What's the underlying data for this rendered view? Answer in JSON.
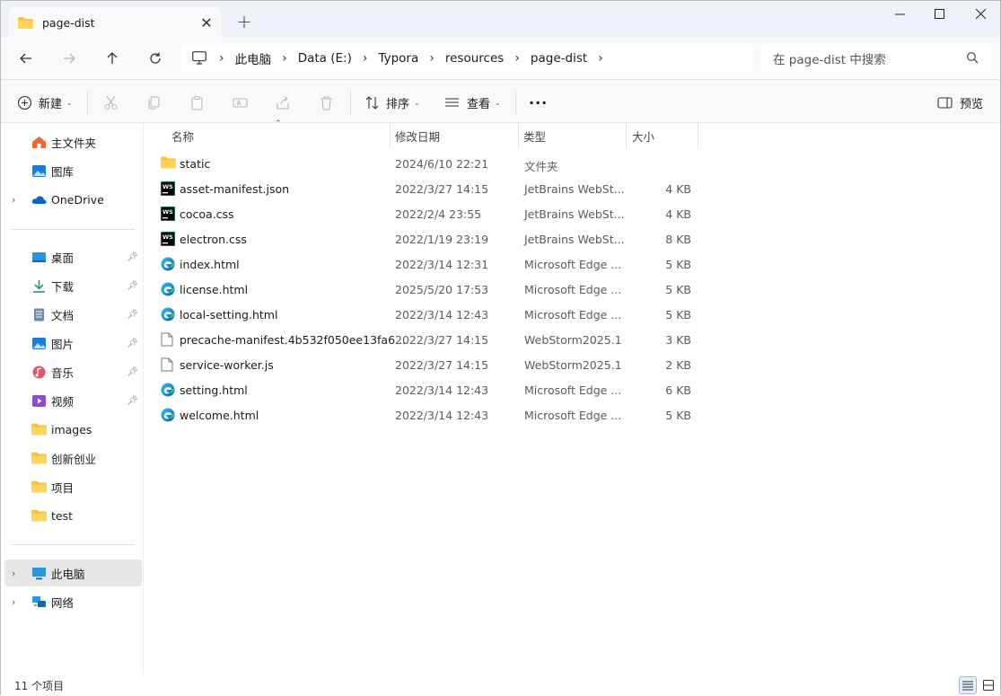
{
  "window": {
    "tab_title": "page-dist",
    "new_tab": "+",
    "minimize": "—",
    "maximize": "☐",
    "close": "✕"
  },
  "address": {
    "segments": [
      "此电脑",
      "Data (E:)",
      "Typora",
      "resources",
      "page-dist"
    ],
    "search_placeholder": "在 page-dist 中搜索"
  },
  "toolbar": {
    "new_label": "新建",
    "sort_label": "排序",
    "view_label": "查看",
    "more_label": "···",
    "preview_label": "预览"
  },
  "sidebar": {
    "items": [
      {
        "label": "主文件夹",
        "icon": "home-icon"
      },
      {
        "label": "图库",
        "icon": "gallery-icon"
      },
      {
        "label": "OneDrive",
        "icon": "cloud-icon"
      },
      {
        "label": "桌面",
        "icon": "desktop-icon",
        "pinned": true
      },
      {
        "label": "下载",
        "icon": "download-icon",
        "pinned": true
      },
      {
        "label": "文档",
        "icon": "document-icon",
        "pinned": true
      },
      {
        "label": "图片",
        "icon": "pictures-icon",
        "pinned": true
      },
      {
        "label": "音乐",
        "icon": "music-icon",
        "pinned": true
      },
      {
        "label": "视频",
        "icon": "video-icon",
        "pinned": true
      },
      {
        "label": "images",
        "icon": "folder-icon"
      },
      {
        "label": "创新创业",
        "icon": "folder-icon"
      },
      {
        "label": "项目",
        "icon": "folder-icon"
      },
      {
        "label": "test",
        "icon": "folder-icon"
      },
      {
        "label": "此电脑",
        "icon": "this-pc-icon"
      },
      {
        "label": "网络",
        "icon": "network-icon"
      }
    ]
  },
  "columns": {
    "name": "名称",
    "date": "修改日期",
    "type": "类型",
    "size": "大小"
  },
  "files": [
    {
      "name": "static",
      "date": "2024/6/10 22:21",
      "type": "文件夹",
      "size": "",
      "icon": "folder"
    },
    {
      "name": "asset-manifest.json",
      "date": "2022/3/27 14:15",
      "type": "JetBrains WebSt...",
      "size": "4 KB",
      "icon": "webstorm"
    },
    {
      "name": "cocoa.css",
      "date": "2022/2/4 23:55",
      "type": "JetBrains WebSt...",
      "size": "4 KB",
      "icon": "webstorm"
    },
    {
      "name": "electron.css",
      "date": "2022/1/19 23:19",
      "type": "JetBrains WebSt...",
      "size": "8 KB",
      "icon": "webstorm"
    },
    {
      "name": "index.html",
      "date": "2022/3/14 12:31",
      "type": "Microsoft Edge ...",
      "size": "5 KB",
      "icon": "edge"
    },
    {
      "name": "license.html",
      "date": "2025/5/20 17:53",
      "type": "Microsoft Edge ...",
      "size": "5 KB",
      "icon": "edge"
    },
    {
      "name": "local-setting.html",
      "date": "2022/3/14 12:43",
      "type": "Microsoft Edge ...",
      "size": "5 KB",
      "icon": "edge"
    },
    {
      "name": "precache-manifest.4b532f050ee13fa6...",
      "date": "2022/3/27 14:15",
      "type": "WebStorm2025.1",
      "size": "3 KB",
      "icon": "blank"
    },
    {
      "name": "service-worker.js",
      "date": "2022/3/27 14:15",
      "type": "WebStorm2025.1",
      "size": "2 KB",
      "icon": "blank"
    },
    {
      "name": "setting.html",
      "date": "2022/3/14 12:43",
      "type": "Microsoft Edge ...",
      "size": "6 KB",
      "icon": "edge"
    },
    {
      "name": "welcome.html",
      "date": "2022/3/14 12:43",
      "type": "Microsoft Edge ...",
      "size": "5 KB",
      "icon": "edge"
    }
  ],
  "status": {
    "count": "11 个项目"
  },
  "colors": {
    "folder": "#f5c244",
    "accent": "#0067c0",
    "selected": "#e6e6e6"
  }
}
